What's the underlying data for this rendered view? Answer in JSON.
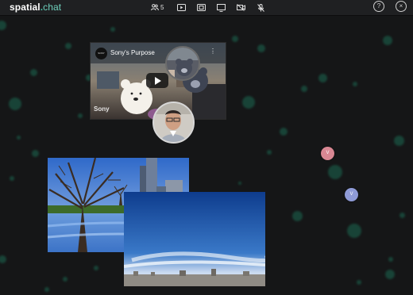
{
  "app": {
    "logo_main": "spatial",
    "logo_dot": ".",
    "logo_sub": "chat"
  },
  "toolbar": {
    "user_count": "5",
    "buttons": [
      "users-icon",
      "video-play-icon",
      "screen-share-icon",
      "monitor-icon",
      "camera-off-icon",
      "mic-off-icon"
    ]
  },
  "header_right": {
    "help": "?",
    "close": "×"
  },
  "video": {
    "channel": "SONY",
    "title": "Sony's Purpose",
    "brand": "Sony",
    "menu": "⋮"
  },
  "guests": [
    {
      "initial": "V",
      "color": "#d88793"
    },
    {
      "initial": "V",
      "color": "#8f9bd7"
    }
  ],
  "colors": {
    "background": "#151617",
    "topbar": "#1f2022",
    "accent": "#3fc0a6",
    "bubble": "#1d7b5f"
  }
}
